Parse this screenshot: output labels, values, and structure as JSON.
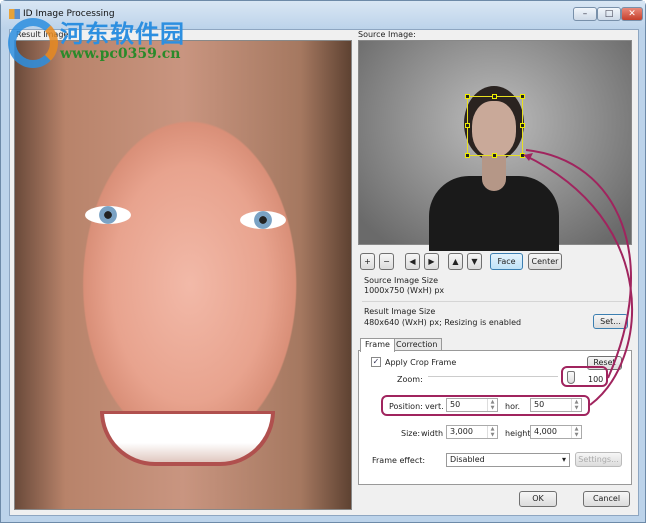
{
  "window": {
    "title": "ID Image Processing",
    "controls": [
      "minimize",
      "maximize",
      "close"
    ]
  },
  "watermark": {
    "text": "河东软件园",
    "url": "www.pc0359.cn"
  },
  "result_panel": {
    "label": "Result Image:"
  },
  "source_panel": {
    "label": "Source Image:"
  },
  "toolbar": {
    "zoom_in": "+",
    "zoom_out": "−",
    "left": "◀",
    "right": "▶",
    "up": "▲",
    "down": "▼",
    "face": "Face",
    "center": "Center"
  },
  "source_size": {
    "title": "Source Image Size",
    "value": "1000x750 (WxH) px"
  },
  "result_size": {
    "title": "Result Image Size",
    "value": "480x640 (WxH) px; Resizing is enabled",
    "set_button": "Set..."
  },
  "tabs": [
    {
      "label": "Frame",
      "active": true
    },
    {
      "label": "Correction",
      "active": false
    }
  ],
  "frame": {
    "apply_crop_label": "Apply Crop Frame",
    "apply_crop_checked": true,
    "check_mark": "✓",
    "reset_button": "Reset",
    "zoom_label": "Zoom:",
    "zoom_value": "100",
    "position_label": "Position:",
    "vert_label": "vert.",
    "vert_value": "50",
    "hor_label": "hor.",
    "hor_value": "50",
    "size_label": "Size:",
    "width_label": "width",
    "width_value": "3,000",
    "height_label": "height",
    "height_value": "4,000",
    "effect_label": "Frame effect:",
    "effect_value": "Disabled",
    "settings_button": "Settings..."
  },
  "footer": {
    "ok": "OK",
    "cancel": "Cancel"
  },
  "colors": {
    "highlight": "#a0245e",
    "crop_frame": "#e8e020",
    "face_button": "#bfe2f8"
  }
}
